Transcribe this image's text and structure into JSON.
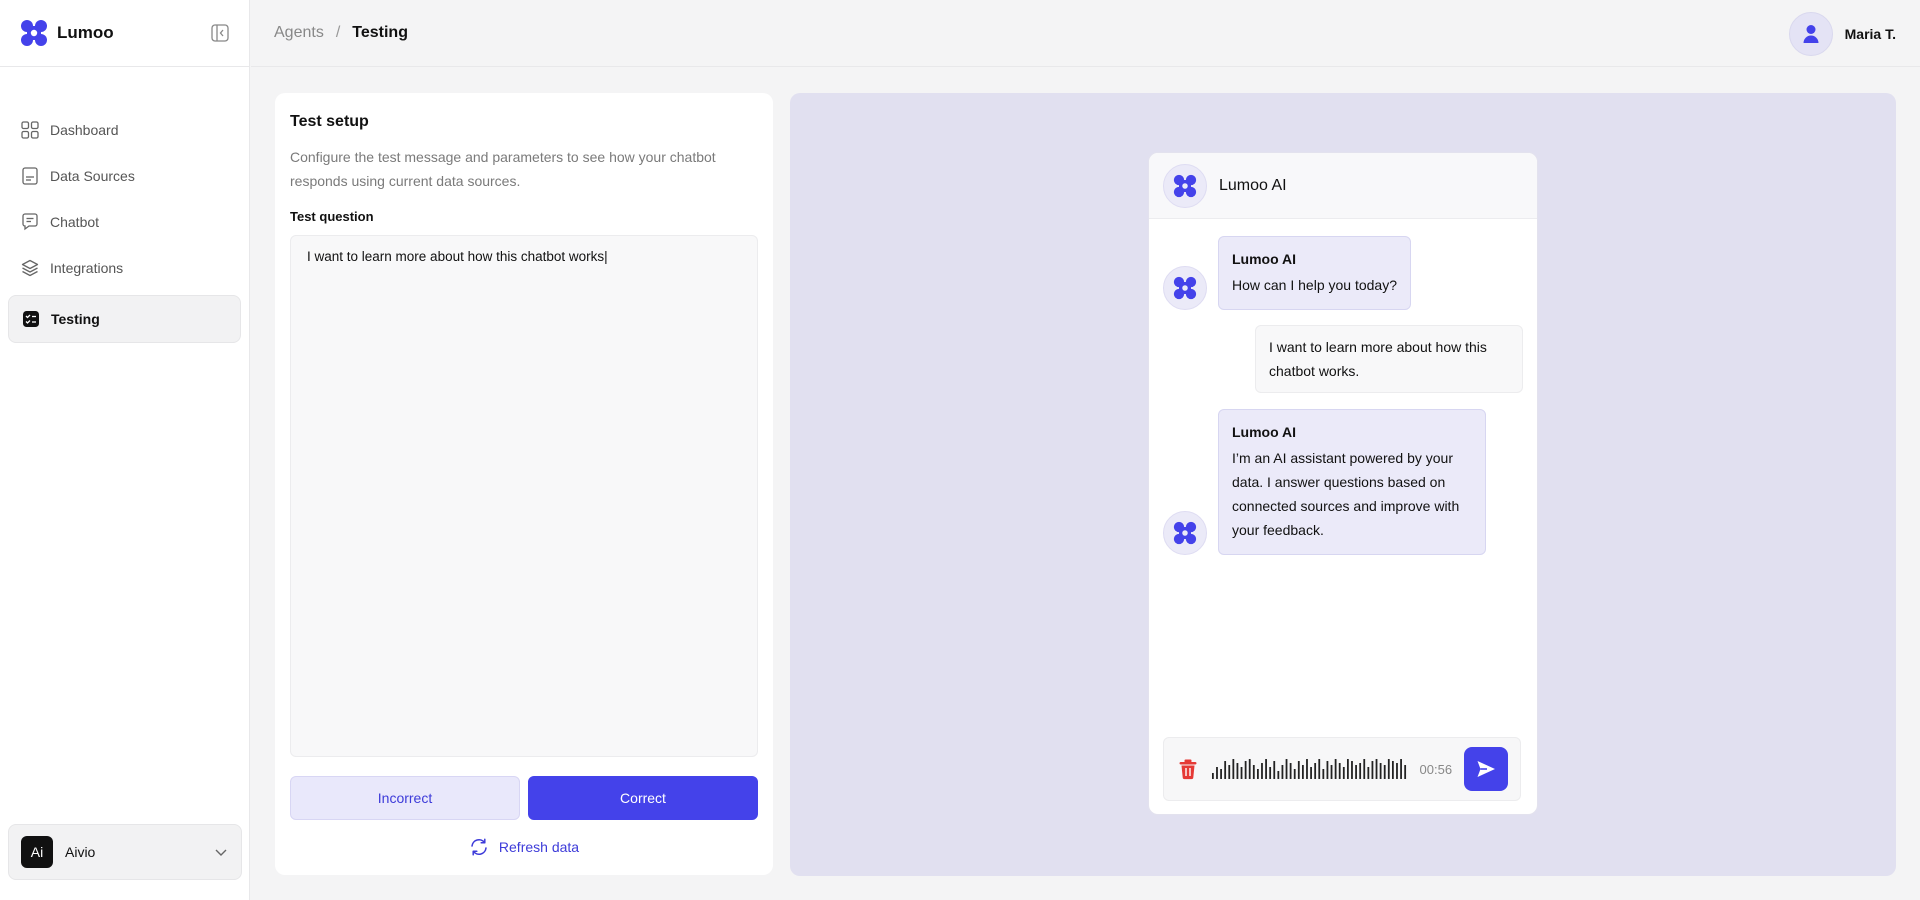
{
  "brand": {
    "name": "Lumoo"
  },
  "sidebar": {
    "items": [
      {
        "label": "Dashboard",
        "icon": "grid-icon"
      },
      {
        "label": "Data Sources",
        "icon": "document-icon"
      },
      {
        "label": "Chatbot",
        "icon": "chat-icon"
      },
      {
        "label": "Integrations",
        "icon": "layers-icon"
      },
      {
        "label": "Testing",
        "icon": "checklist-icon",
        "active": true
      }
    ]
  },
  "workspace": {
    "initials": "Ai",
    "name": "Aivio"
  },
  "header": {
    "breadcrumb_parent": "Agents",
    "breadcrumb_separator": "/",
    "breadcrumb_current": "Testing"
  },
  "user": {
    "name": "Maria T."
  },
  "setup": {
    "title": "Test setup",
    "description": "Configure the test message and parameters to see how your chatbot responds using current data sources.",
    "question_label": "Test question",
    "question_value": "I want to learn more about how this chatbot works|",
    "incorrect_label": "Incorrect",
    "correct_label": "Correct",
    "refresh_label": "Refresh data"
  },
  "chat": {
    "bot_name": "Lumoo AI",
    "messages": [
      {
        "role": "bot",
        "sender": "Lumoo AI",
        "text": "How can I help you today?"
      },
      {
        "role": "user",
        "text": "I want to learn more about how this chatbot works."
      },
      {
        "role": "bot",
        "sender": "Lumoo AI",
        "text": "I’m an AI assistant powered by your data. I answer questions based on connected sources and improve with your feedback."
      }
    ],
    "recording_time": "00:56"
  },
  "colors": {
    "accent": "#4442ea",
    "preview_bg": "#e1e0f0",
    "bot_bubble": "#ebeaf9",
    "delete_red": "#e53935"
  }
}
